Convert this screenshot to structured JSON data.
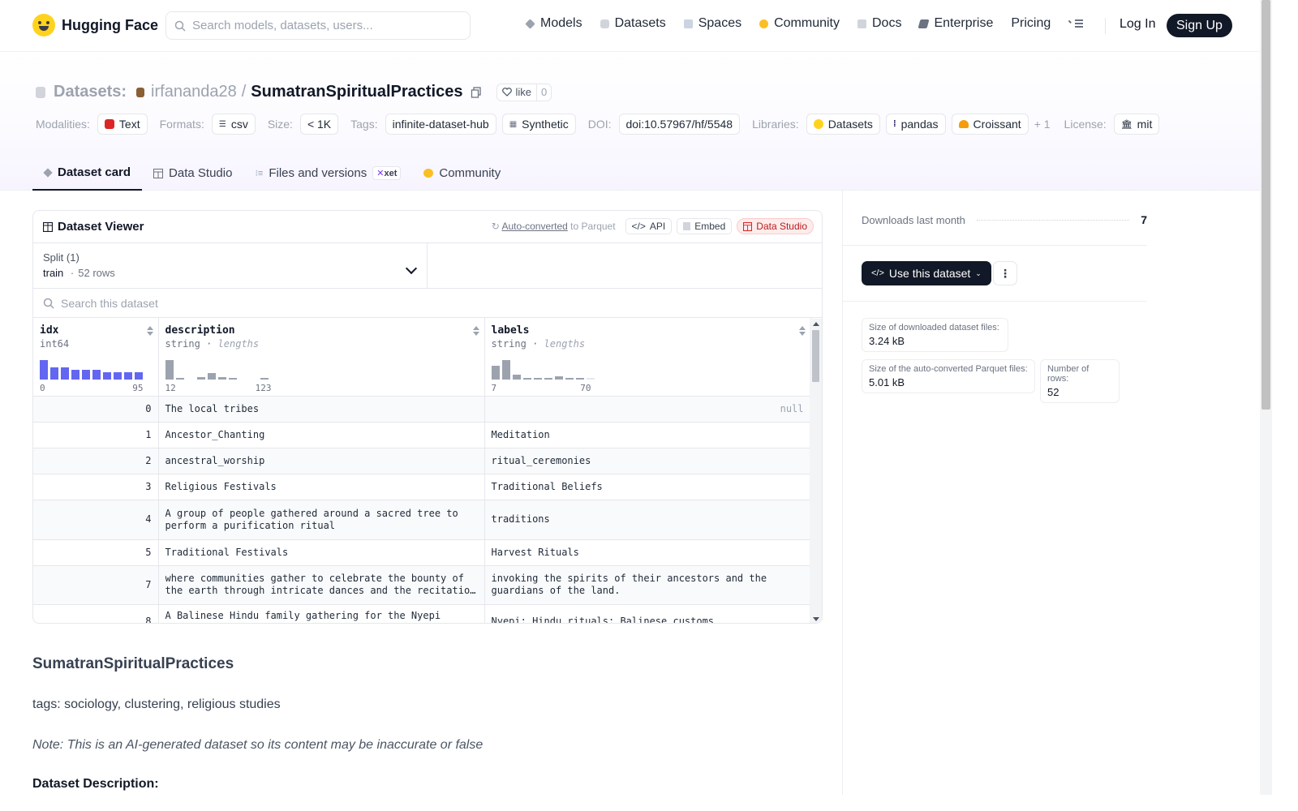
{
  "nav": {
    "logo_text": "Hugging Face",
    "search_placeholder": "Search models, datasets, users...",
    "links": [
      "Models",
      "Datasets",
      "Spaces",
      "Community",
      "Docs",
      "Enterprise",
      "Pricing"
    ],
    "login": "Log In",
    "signup": "Sign Up"
  },
  "header": {
    "section_label": "Datasets:",
    "owner": "irfananda28",
    "separator": "/",
    "name": "SumatranSpiritualPractices",
    "like_label": "like",
    "like_count": "0",
    "modalities_label": "Modalities:",
    "modality": "Text",
    "formats_label": "Formats:",
    "format": "csv",
    "size_label": "Size:",
    "size": "< 1K",
    "tags_label": "Tags:",
    "tags": [
      "infinite-dataset-hub",
      "Synthetic"
    ],
    "doi_label": "DOI:",
    "doi": "doi:10.57967/hf/5548",
    "libraries_label": "Libraries:",
    "libraries": [
      "Datasets",
      "pandas",
      "Croissant"
    ],
    "libraries_more": "+ 1",
    "license_label": "License:",
    "license": "mit"
  },
  "tabs": {
    "card": "Dataset card",
    "studio": "Data Studio",
    "files": "Files and versions",
    "xet": "xet",
    "community": "Community"
  },
  "viewer": {
    "title": "Dataset Viewer",
    "auto_converted": "Auto-converted",
    "to_parquet": "to Parquet",
    "api": "API",
    "embed": "Embed",
    "data_studio": "Data Studio",
    "split_label": "Split (1)",
    "split_name": "train",
    "split_dot": "·",
    "split_rows": "52 rows",
    "search_placeholder": "Search this dataset",
    "columns": [
      {
        "name": "idx",
        "type": "int64",
        "type_extra": "",
        "min": "0",
        "max": "95"
      },
      {
        "name": "description",
        "type": "string",
        "type_extra": "lengths",
        "min": "12",
        "max": "123"
      },
      {
        "name": "labels",
        "type": "string",
        "type_extra": "lengths",
        "min": "7",
        "max": "70"
      }
    ],
    "type_sep": " · ",
    "rows": [
      {
        "idx": "0",
        "description": "The local tribes",
        "labels": "null"
      },
      {
        "idx": "1",
        "description": "Ancestor_Chanting",
        "labels": "Meditation"
      },
      {
        "idx": "2",
        "description": "ancestral_worship",
        "labels": "ritual_ceremonies"
      },
      {
        "idx": "3",
        "description": "Religious Festivals",
        "labels": "Traditional Beliefs"
      },
      {
        "idx": "4",
        "description": "A group of people gathered around a sacred tree to perform a purification ritual",
        "labels": "traditions"
      },
      {
        "idx": "5",
        "description": "Traditional Festivals",
        "labels": "Harvest Rituals"
      },
      {
        "idx": "7",
        "description": "where communities gather to celebrate the bounty of the earth through intricate dances and the recitation of…",
        "labels": "invoking the spirits of their ancestors and the guardians of the land."
      },
      {
        "idx": "8",
        "description": "A Balinese Hindu family gathering for the Nyepi ceremony",
        "labels": "Nyepi; Hindu rituals; Balinese customs"
      }
    ]
  },
  "card": {
    "title": "SumatranSpiritualPractices",
    "tags_line": "tags: sociology, clustering, religious studies",
    "note": "Note: This is an AI-generated dataset so its content may be inaccurate or false",
    "desc_heading": "Dataset Description:"
  },
  "sidebar": {
    "downloads_label": "Downloads last month",
    "downloads_value": "7",
    "use_button": "Use this dataset",
    "size_dl_label": "Size of downloaded dataset files:",
    "size_dl_value": "3.24 kB",
    "size_pq_label": "Size of the auto-converted Parquet files:",
    "size_pq_value": "5.01 kB",
    "rows_label": "Number of rows:",
    "rows_value": "52"
  },
  "colors": {
    "accent_hist_int": "#6366f1",
    "hist_string": "#9ca3af",
    "brand_yellow": "#ffd21e"
  },
  "icons": [
    "search-icon",
    "models-icon",
    "datasets-icon",
    "spaces-icon",
    "community-icon",
    "docs-icon",
    "enterprise-icon",
    "menu-icon",
    "copy-icon",
    "heart-icon",
    "table-icon",
    "refresh-icon",
    "code-icon",
    "embed-icon",
    "chevron-down-icon",
    "sort-icon",
    "more-icon"
  ]
}
